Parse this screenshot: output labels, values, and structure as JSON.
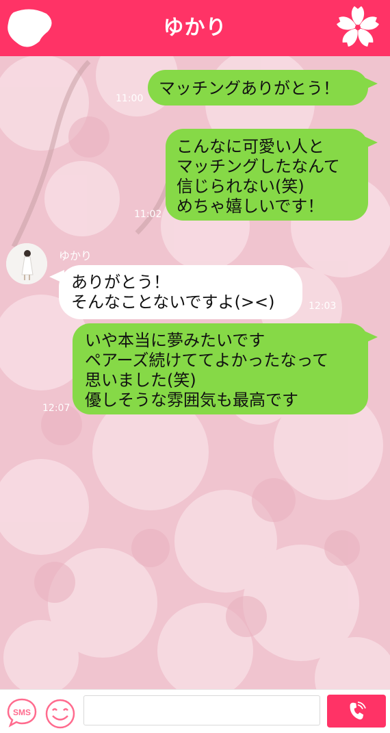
{
  "header": {
    "title": "ゆかり",
    "back_icon": "back-icon",
    "menu_icon": "sakura-icon"
  },
  "colors": {
    "header": "#ff3366",
    "sent_bubble": "#86d947",
    "received_bubble": "#ffffff",
    "background": "#f2c9d2"
  },
  "messages": [
    {
      "side": "sent",
      "time": "11:00",
      "lines": [
        "マッチングありがとう！"
      ]
    },
    {
      "side": "sent",
      "time": "11:02",
      "lines": [
        "こんなに可愛い人と",
        "マッチングしたなんて",
        "信じられない(笑)",
        "めちゃ嬉しいです！"
      ]
    },
    {
      "side": "received",
      "sender": "ゆかり",
      "time": "12:03",
      "lines": [
        "ありがとう！",
        "そんなことないですよ(><)"
      ]
    },
    {
      "side": "sent",
      "time": "12:07",
      "lines": [
        "いや本当に夢みたいです",
        "ペアーズ続けててよかったなって",
        "思いました(笑)",
        "優しそうな雰囲気も最高です"
      ]
    }
  ],
  "footer": {
    "sms_label": "SMS",
    "input_value": "",
    "input_placeholder": "",
    "call_icon": "phone-icon"
  }
}
